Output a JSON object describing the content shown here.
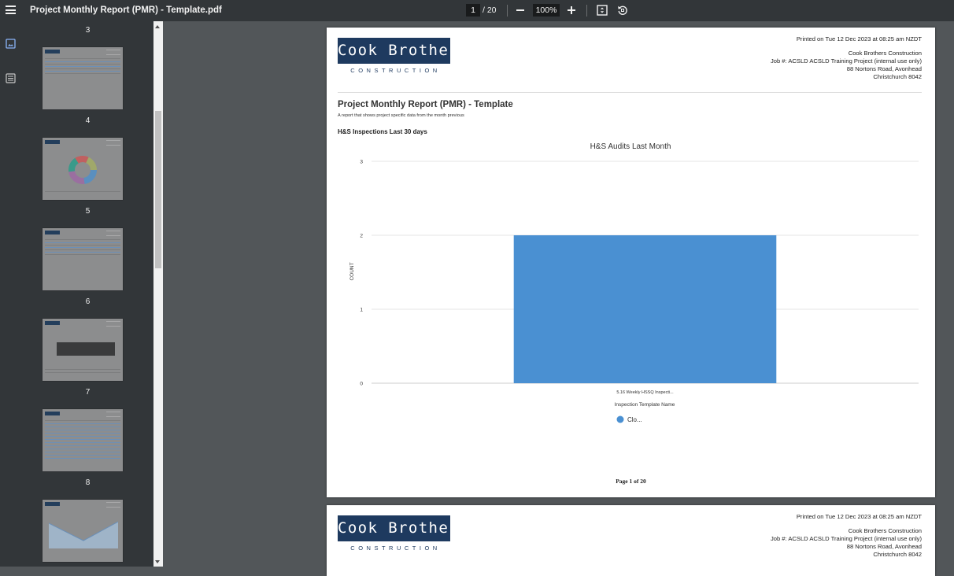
{
  "toolbar": {
    "title": "Project Monthly Report (PMR) - Template.pdf",
    "current_page": "1",
    "total_pages": "/ 20",
    "zoom": "100%"
  },
  "sidebar": {
    "thumbnails": [
      {
        "label": "3"
      },
      {
        "label": "4"
      },
      {
        "label": "5"
      },
      {
        "label": "6"
      },
      {
        "label": "7"
      },
      {
        "label": "8"
      }
    ]
  },
  "page1": {
    "logo_name": "Cook Brothers",
    "logo_sub": "CONSTRUCTION",
    "printed": "Printed on Tue 12 Dec 2023 at 08:25 am NZDT",
    "company": "Cook Brothers Construction",
    "job": "Job #: ACSLD ACSLD Training Project (internal use only)",
    "address1": "88 Nortons Road, Avonhead",
    "address2": "Christchurch 8042",
    "report_title": "Project Monthly Report (PMR) - Template",
    "report_desc": "A report that shows project specific data from the month previous",
    "section_title": "H&S Inspections Last 30 days",
    "footer": "Page 1 of 20"
  },
  "page2": {
    "logo_name": "Cook Brothers",
    "logo_sub": "CONSTRUCTION",
    "printed": "Printed on Tue 12 Dec 2023 at 08:25 am NZDT",
    "company": "Cook Brothers Construction",
    "job": "Job #: ACSLD ACSLD Training Project (internal use only)",
    "address1": "88 Nortons Road, Avonhead",
    "address2": "Christchurch 8042"
  },
  "colors": {
    "bar": "#4a90d2",
    "logo": "#1e3a5f"
  },
  "chart_data": {
    "type": "bar",
    "title": "H&S Audits Last Month",
    "categories": [
      "5.16 Weekly HSSQ Inspecti..."
    ],
    "series": [
      {
        "name": "Clo...",
        "values": [
          2
        ]
      }
    ],
    "xlabel": "Inspection Template Name",
    "ylabel": "COUNT",
    "ylim": [
      0,
      3
    ],
    "yticks": [
      "0",
      "1",
      "2",
      "3"
    ],
    "grid": true,
    "legend": "bottom"
  }
}
